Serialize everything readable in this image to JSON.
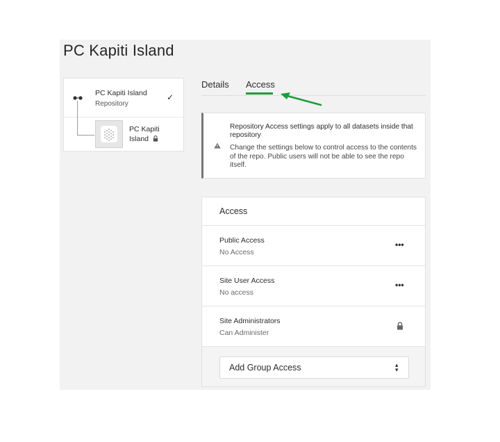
{
  "page": {
    "title": "PC Kapiti Island"
  },
  "tree": {
    "repo": {
      "name": "PC Kapiti Island",
      "type": "Repository",
      "selected_icon": "check-icon"
    },
    "dataset": {
      "name_line1": "PC Kapiti",
      "name_line2": "Island",
      "icon": "lock-icon"
    }
  },
  "tabs": [
    {
      "label": "Details",
      "active": false
    },
    {
      "label": "Access",
      "active": true
    }
  ],
  "colors": {
    "accent": "#1f9a3e",
    "panel": "#f2f2f2"
  },
  "info": {
    "heading": "Repository Access settings apply to all datasets inside that repository",
    "body": "Change the settings below to control access to the contents of the repo. Public users will not be able to see the repo itself."
  },
  "access": {
    "title": "Access",
    "rows": [
      {
        "label": "Public Access",
        "value": "No Access",
        "action": "•••"
      },
      {
        "label": "Site User Access",
        "value": "No access",
        "action": "•••"
      },
      {
        "label": "Site Administrators",
        "value": "Can Administer",
        "action": "lock-icon"
      }
    ],
    "add_group_label": "Add Group Access"
  }
}
